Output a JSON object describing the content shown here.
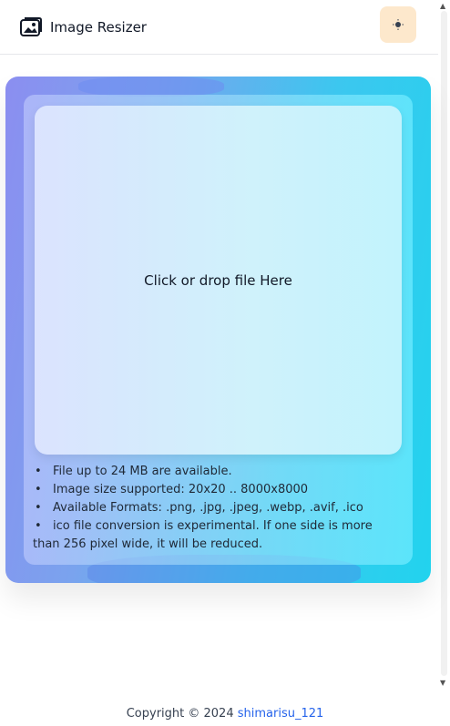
{
  "header": {
    "title": "Image Resizer",
    "logo_icon": "image-icon",
    "theme_toggle_icon": "sun-icon",
    "theme_toggle_bg": "#fde8cc"
  },
  "dropzone": {
    "label": "Click or drop file Here"
  },
  "info": [
    "File up to 24 MB are available.",
    "Image size supported: 20x20 .. 8000x8000",
    "Available Formats: .png, .jpg, .jpeg, .webp, .avif, .ico",
    "ico file conversion is experimental. If one side is more than 256 pixel wide, it will be reduced."
  ],
  "footer": {
    "prefix": "Copyright © 2024",
    "author": "shimarisu_121"
  },
  "colors": {
    "gradient_start": "#8b8ef0",
    "gradient_end": "#22d3ee",
    "link": "#2563eb"
  }
}
